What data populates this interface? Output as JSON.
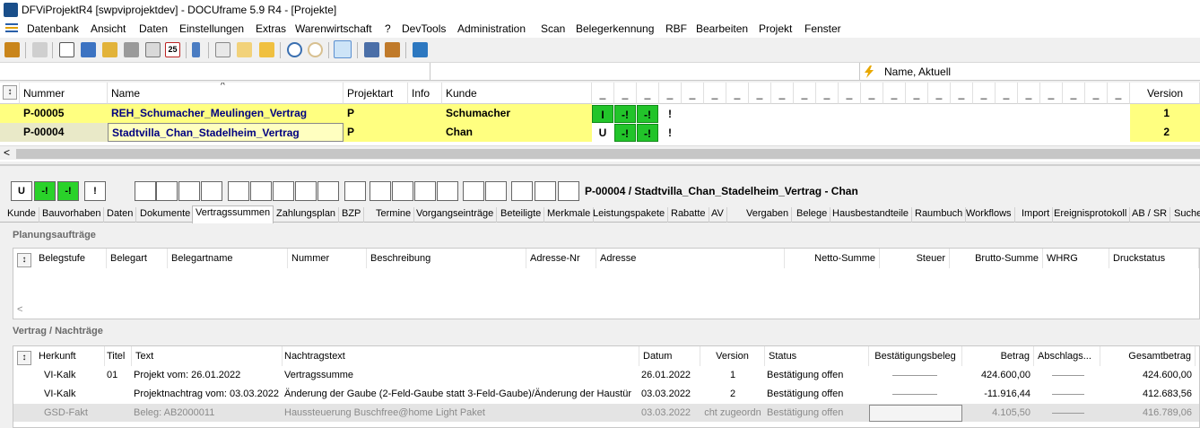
{
  "window": {
    "title": "DFViProjektR4 [swpviprojektdev] - DOCUframe 5.9 R4 - [Projekte]"
  },
  "menu": [
    "Datenbank",
    "Ansicht",
    "Daten",
    "Einstellungen",
    "Extras",
    "Warenwirtschaft",
    "?",
    "DevTools",
    "Administration",
    "Scan",
    "Belegerkennung",
    "RBF",
    "Bearbeiten",
    "Projekt",
    "Fenster"
  ],
  "toolbar_icons": [
    "project-icon",
    "print-icon",
    "card-icon",
    "list-icon",
    "folder-icon",
    "tag-icon",
    "doc-icon",
    "calendar-icon",
    "phone-icon",
    "copy-icon",
    "mail-icon",
    "folder-open-icon",
    "search-icon",
    "search-disabled-icon",
    "view-icon",
    "people-icon",
    "team-icon",
    "export-icon"
  ],
  "calendar_label": "25",
  "filter": {
    "label": "Name, Aktuell"
  },
  "grid": {
    "headers": {
      "nummer": "Nummer",
      "name": "Name",
      "projektart": "Projektart",
      "info": "Info",
      "kunde": "Kunde",
      "version": "Version",
      "status_placeholder": "_"
    },
    "rows": [
      {
        "nummer": "P-00005",
        "name": "REH_Schumacher_Meulingen_Vertrag",
        "projektart": "P",
        "info": "",
        "kunde": "Schumacher",
        "s1": "I",
        "s2": "-!",
        "s3": "-!",
        "s4": "!",
        "version": "1"
      },
      {
        "nummer": "P-00004",
        "name": "Stadtvilla_Chan_Stadelheim_Vertrag",
        "projektart": "P",
        "info": "",
        "kunde": "Chan",
        "s1": "U",
        "s2": "-!",
        "s3": "-!",
        "s4": "!",
        "version": "2"
      }
    ]
  },
  "status_boxes": [
    "U",
    "-!",
    "-!",
    "!"
  ],
  "detail_title": "P-00004 / Stadtvilla_Chan_Stadelheim_Vertrag - Chan",
  "tabs": [
    "Kunde",
    "Bauvorhaben",
    "Daten",
    "Dokumente",
    "Vertragssummen",
    "Zahlungsplan",
    "BZP",
    "Termine",
    "Vorgangseinträge",
    "Beteiligte",
    "Merkmale",
    "Leistungspakete",
    "Rabatte",
    "AV",
    "Vergaben",
    "Belege",
    "Hausbestandteile",
    "Raumbuch",
    "Workflows",
    "Import",
    "Ereignisprotokoll",
    "AB / SR",
    "Suche"
  ],
  "active_tab": "Vertragssummen",
  "planung": {
    "title": "Planungsaufträge",
    "headers": [
      "Belegstufe",
      "Belegart",
      "Belegartname",
      "Nummer",
      "Beschreibung",
      "Adresse-Nr",
      "Adresse",
      "Netto-Summe",
      "Steuer",
      "Brutto-Summe",
      "WHRG",
      "Druckstatus"
    ]
  },
  "vertrag": {
    "title": "Vertrag / Nachträge",
    "headers": {
      "herkunft": "Herkunft",
      "titel": "Titel",
      "text": "Text",
      "nachtragstext": "Nachtragstext",
      "datum": "Datum",
      "version": "Version",
      "status": "Status",
      "bestaetigungsbeleg": "Bestätigungsbeleg",
      "betrag": "Betrag",
      "abschlag": "Abschlags...",
      "gesamtbetrag": "Gesamtbetrag"
    },
    "rows": [
      {
        "herkunft": "VI-Kalk",
        "titel": "01",
        "text": "Projekt vom: 26.01.2022",
        "nachtragstext": "Vertragssumme",
        "datum": "26.01.2022",
        "version": "1",
        "status": "Bestätigung offen",
        "betrag": "424.600,00",
        "gesamtbetrag": "424.600,00"
      },
      {
        "herkunft": "VI-Kalk",
        "titel": "",
        "text": "Projektnachtrag vom: 03.03.2022",
        "nachtragstext": "Änderung der Gaube (2-Feld-Gaube statt 3-Feld-Gaube)/Änderung der Haustür",
        "datum": "03.03.2022",
        "version": "2",
        "status": "Bestätigung offen",
        "betrag": "-11.916,44",
        "gesamtbetrag": "412.683,56"
      },
      {
        "herkunft": "GSD-Fakt",
        "titel": "",
        "text": "Beleg: AB2000011",
        "nachtragstext": "Haussteuerung Buschfree@home Light Paket",
        "datum": "03.03.2022",
        "version": "cht zugeordn",
        "status": "Bestätigung offen",
        "betrag": "4.105,50",
        "gesamtbetrag": "416.789,06"
      }
    ]
  },
  "colors": {
    "highlight_row": "#ffff80",
    "selected_row": "#e9e9c8",
    "status_green": "#22c42a",
    "link_blue": "#000080"
  }
}
